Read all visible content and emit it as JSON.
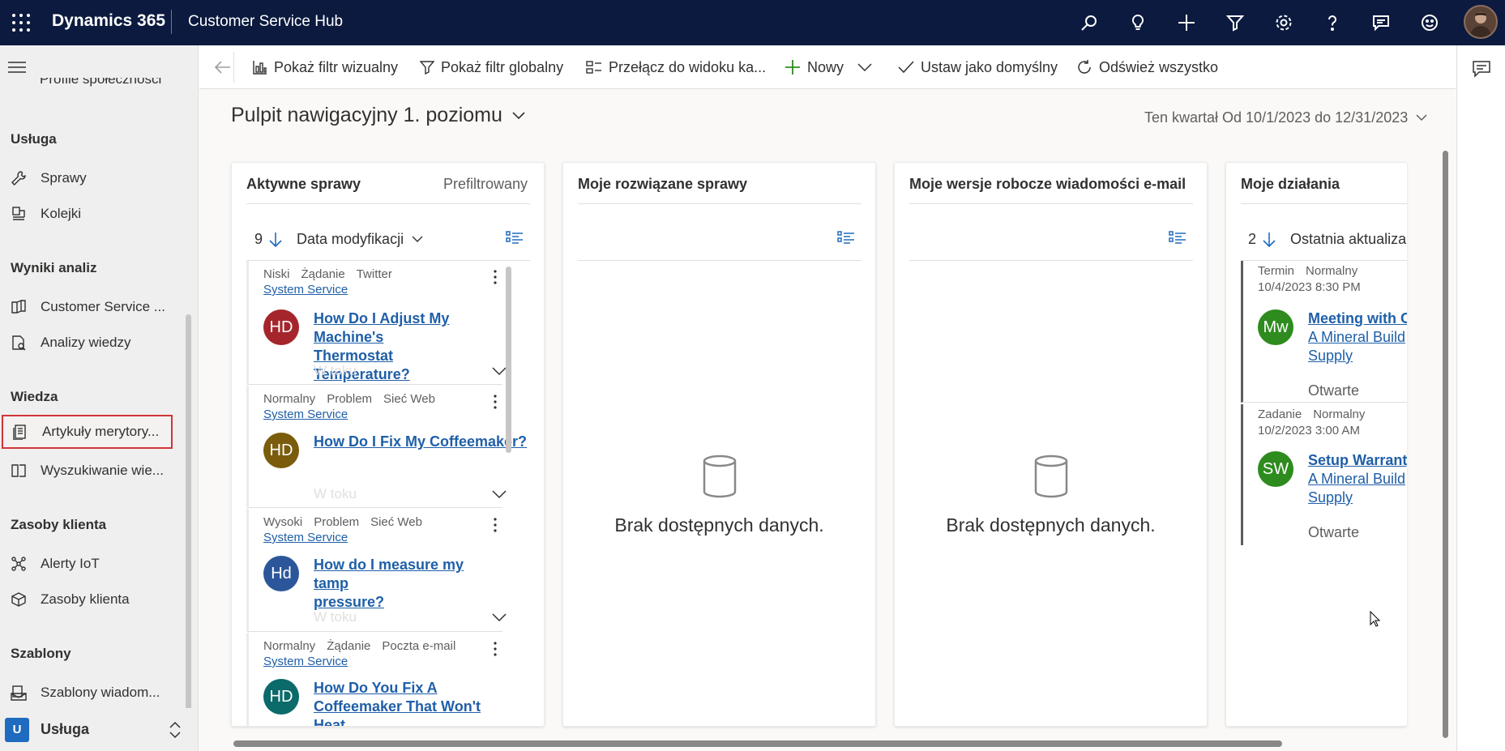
{
  "topbar": {
    "brand": "Dynamics 365",
    "app_name": "Customer Service Hub",
    "icons": [
      "search-icon",
      "lightbulb-icon",
      "add-icon",
      "filter-icon",
      "settings-icon",
      "help-icon",
      "chat-icon",
      "smiley-icon",
      "user-avatar"
    ]
  },
  "sidebar": {
    "partial_item": "Profile społeczności",
    "groups": [
      {
        "title": "Usługa",
        "items": [
          {
            "label": "Sprawy",
            "icon": "wrench-icon"
          },
          {
            "label": "Kolejki",
            "icon": "queue-icon"
          }
        ]
      },
      {
        "title": "Wyniki analiz",
        "items": [
          {
            "label": "Customer Service ...",
            "icon": "book-icon"
          },
          {
            "label": "Analizy wiedzy",
            "icon": "insights-icon"
          }
        ]
      },
      {
        "title": "Wiedza",
        "items": [
          {
            "label": "Artykuły merytory...",
            "icon": "document-icon"
          },
          {
            "label": "Wyszukiwanie wie...",
            "icon": "book-search-icon"
          }
        ]
      },
      {
        "title": "Zasoby klienta",
        "items": [
          {
            "label": "Alerty IoT",
            "icon": "iot-icon"
          },
          {
            "label": "Zasoby klienta",
            "icon": "box-icon"
          }
        ]
      },
      {
        "title": "Szablony",
        "items": [
          {
            "label": "Szablony wiadom...",
            "icon": "mail-template-icon"
          }
        ]
      }
    ],
    "area": {
      "badge": "U",
      "label": "Usługa"
    }
  },
  "commandbar": {
    "visual_filter": "Pokaż filtr wizualny",
    "global_filter": "Pokaż filtr globalny",
    "switch_view": "Przełącz do widoku ka...",
    "new": "Nowy",
    "set_default": "Ustaw jako domyślny",
    "refresh_all": "Odśwież wszystko"
  },
  "dashboard": {
    "title": "Pulpit nawigacyjny 1. poziomu",
    "period": "Ten kwartał Od 10/1/2023 do 12/31/2023"
  },
  "cards": {
    "active_cases": {
      "title": "Aktywne sprawy",
      "subtitle": "Prefiltrowany",
      "count": "9",
      "sort_field": "Data modyfikacji",
      "items": [
        {
          "priority": "Niski",
          "type": "Żądanie",
          "origin": "Twitter",
          "owner": "System Service",
          "initials": "HD",
          "color": "#a4262c",
          "title_1": "How Do I Adjust My Machine's",
          "title_2": "Thermostat Temperature?",
          "status": "W toku"
        },
        {
          "priority": "Normalny",
          "type": "Problem",
          "origin": "Sieć Web",
          "owner": "System Service",
          "initials": "HD",
          "color": "#7a5c0c",
          "title_1": "How Do I Fix My Coffeemaker?",
          "title_2": "",
          "status": "W toku"
        },
        {
          "priority": "Wysoki",
          "type": "Problem",
          "origin": "Sieć Web",
          "owner": "System Service",
          "initials": "Hd",
          "color": "#2b579a",
          "title_1": "How do I measure my tamp",
          "title_2": "pressure?",
          "status": "W toku"
        },
        {
          "priority": "Normalny",
          "type": "Żądanie",
          "origin": "Poczta e-mail",
          "owner": "System Service",
          "initials": "HD",
          "color": "#0b6a6a",
          "title_1": "How Do You Fix A",
          "title_2": "Coffeemaker That Won't Heat",
          "status": ""
        }
      ]
    },
    "resolved_cases": {
      "title": "Moje rozwiązane sprawy",
      "empty": "Brak dostępnych danych."
    },
    "email_drafts": {
      "title": "Moje wersje robocze wiadomości e-mail",
      "empty": "Brak dostępnych danych."
    },
    "activities": {
      "title": "Moje działania",
      "count": "2",
      "sort_field": "Ostatnia aktualizac",
      "items": [
        {
          "type": "Termin",
          "priority": "Normalny",
          "date": "10/4/2023 8:30 PM",
          "initials": "Mw",
          "color": "#2e8b1e",
          "title_1": "Meeting with O",
          "title_2": "A Mineral Build",
          "title_3": "Supply",
          "status": "Otwarte"
        },
        {
          "type": "Zadanie",
          "priority": "Normalny",
          "date": "10/2/2023 3:00 AM",
          "initials": "SW",
          "color": "#2e8b1e",
          "title_1": "Setup Warranty",
          "title_2": "A Mineral Build",
          "title_3": "Supply",
          "status": "Otwarte"
        }
      ]
    }
  }
}
